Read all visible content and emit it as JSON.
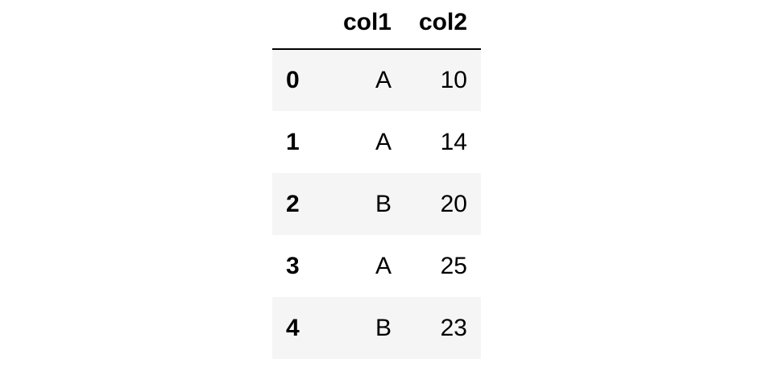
{
  "table": {
    "index_header": "",
    "columns": [
      "col1",
      "col2"
    ],
    "rows": [
      {
        "index": "0",
        "col1": "A",
        "col2": "10"
      },
      {
        "index": "1",
        "col1": "A",
        "col2": "14"
      },
      {
        "index": "2",
        "col1": "B",
        "col2": "20"
      },
      {
        "index": "3",
        "col1": "A",
        "col2": "25"
      },
      {
        "index": "4",
        "col1": "B",
        "col2": "23"
      }
    ]
  }
}
